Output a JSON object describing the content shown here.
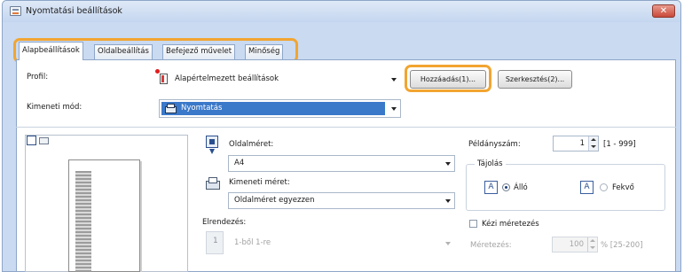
{
  "window": {
    "title": "Nyomtatási beállítások",
    "close_label": "✕"
  },
  "tabs": [
    {
      "label": "Alapbeállítások",
      "active": true
    },
    {
      "label": "Oldalbeállítás",
      "active": false
    },
    {
      "label": "Befejező művelet",
      "active": false
    },
    {
      "label": "Minőség",
      "active": false
    }
  ],
  "profile": {
    "label": "Profil:",
    "value": "Alapértelmezett beállítások",
    "add_button": "Hozzáadás(1)...",
    "edit_button": "Szerkesztés(2)..."
  },
  "output": {
    "label": "Kimeneti mód:",
    "value": "Nyomtatás"
  },
  "page_size": {
    "label": "Oldalméret:",
    "value": "A4"
  },
  "output_size": {
    "label": "Kimeneti méret:",
    "value": "Oldalméret egyezzen"
  },
  "layout": {
    "label": "Elrendezés:",
    "value": "1-ből 1-re",
    "icon_text": "1"
  },
  "copies": {
    "label": "Példányszám:",
    "value": "1",
    "range": "[1 - 999]"
  },
  "orientation": {
    "title": "Tájolás",
    "portrait_label": "Álló",
    "landscape_label": "Fekvő",
    "icon_letter": "A",
    "selected": "Álló"
  },
  "manual_scaling": {
    "label": "Kézi méretezés",
    "checked": false
  },
  "scaling": {
    "label": "Méretezés:",
    "value": "100",
    "range": "% [25-200]"
  },
  "icons": {
    "app": "printer-settings-icon",
    "profile": "profile-document-icon",
    "output": "printer-icon",
    "page_size": "page-size-icon",
    "output_size": "printer-output-icon"
  },
  "colors": {
    "highlight": "#f2a531",
    "selection": "#3a78c9",
    "close": "#c9483a"
  }
}
